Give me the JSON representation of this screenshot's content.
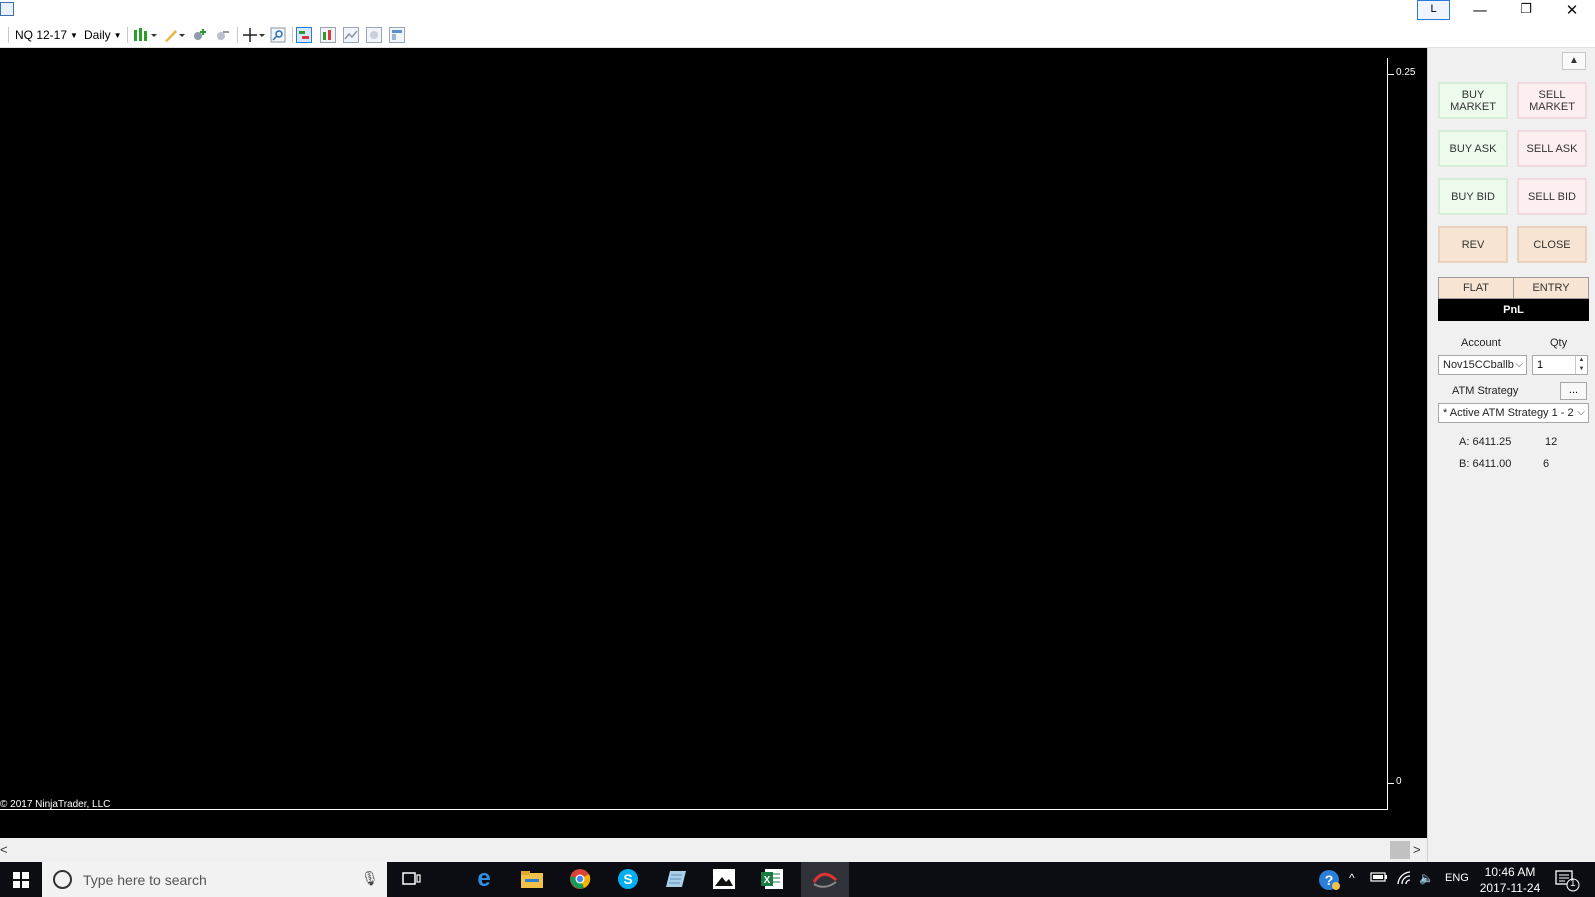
{
  "titlebar": {
    "layout_label": "L",
    "min_glyph": "—",
    "max_glyph": "❐",
    "close_glyph": "✕"
  },
  "toolbar": {
    "instrument": "NQ 12-17",
    "interval": "Daily"
  },
  "chart": {
    "y_ticks": [
      "0.25",
      "0"
    ],
    "copyright": "© 2017 NinjaTrader, LLC"
  },
  "trader": {
    "scroll_up": "▲",
    "buy_market": "BUY MARKET",
    "sell_market": "SELL MARKET",
    "buy_ask": "BUY ASK",
    "sell_ask": "SELL ASK",
    "buy_bid": "BUY BID",
    "sell_bid": "SELL BID",
    "rev": "REV",
    "close": "CLOSE",
    "position_status": "FLAT",
    "entry_label": "ENTRY",
    "pnl_label": "PnL",
    "account_label": "Account",
    "account_value": "Nov15CCballb",
    "qty_label": "Qty",
    "qty_value": "1",
    "atm_label": "ATM Strategy",
    "atm_button": "...",
    "atm_value": "* Active ATM Strategy 1 - 2",
    "ask_text": "A: 6411.25",
    "ask_size": "12",
    "bid_text": "B: 6411.00",
    "bid_size": "6"
  },
  "taskbar": {
    "search_placeholder": "Type here to search",
    "language": "ENG",
    "time": "10:46 AM",
    "date": "2017-11-24",
    "notification_count": "1"
  }
}
